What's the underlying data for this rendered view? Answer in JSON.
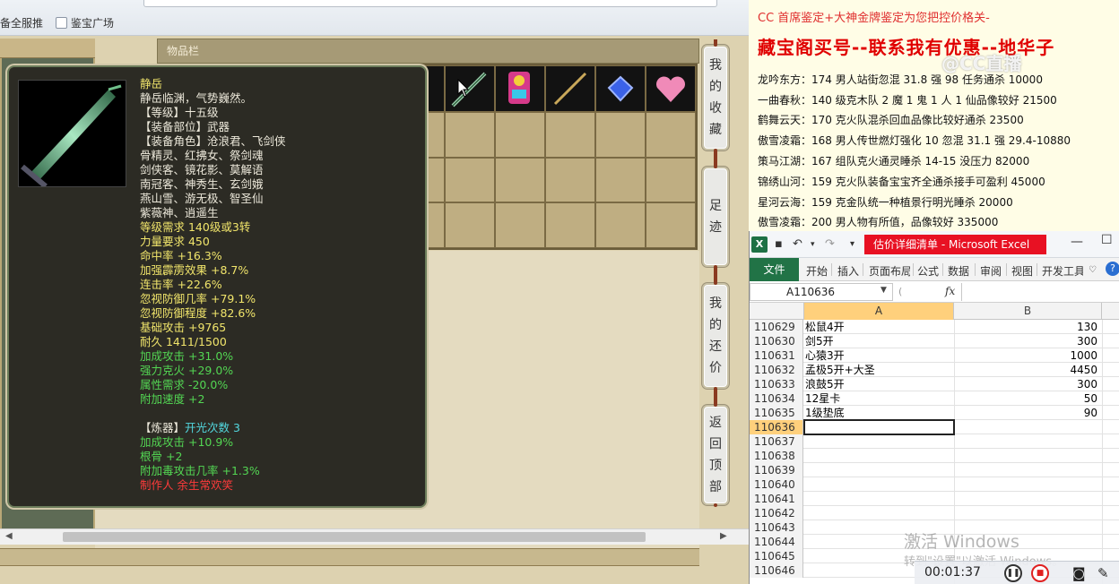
{
  "browser": {
    "bookmarks": [
      "备全服推",
      "鉴宝广场"
    ]
  },
  "game": {
    "items_title": "物品栏",
    "side_buttons": [
      [
        "我",
        "的",
        "收",
        "藏"
      ],
      [
        "足",
        "迹"
      ],
      [
        "我",
        "的",
        "还",
        "价"
      ],
      [
        "返",
        "回",
        "顶",
        "部"
      ]
    ],
    "tooltip": {
      "name": "静岳",
      "desc": "静岳临渊，气势巍然。",
      "level_line": "【等级】十五级",
      "slot_line": "【装备部位】武器",
      "roles_line": "【装备角色】沧浪君、飞剑侠",
      "roles": [
        "骨精灵、红拂女、祭剑魂",
        "剑侠客、镜花影、莫解语",
        "南冠客、神秀生、玄剑娥",
        "燕山雪、游无极、智圣仙",
        "紫薇神、逍遥生"
      ],
      "requirement": "等级需求 140级或3转",
      "strength": "力量要求 450",
      "stats": [
        "命中率 +16.3%",
        "加强霹雳效果 +8.7%",
        "连击率 +22.6%",
        "忽视防御几率 +79.1%",
        "忽视防御程度 +82.6%",
        "基础攻击 +9765",
        "耐久 1411/1500"
      ],
      "green_stats": [
        "加成攻击 +31.0%",
        "强力克火 +29.0%",
        "属性需求 -20.0%",
        "附加速度 +2"
      ],
      "refine_label": "【炼器】",
      "refine_value": "开光次数 3",
      "refine_stats": [
        "加成攻击 +10.9%",
        "根骨 +2",
        "附加毒攻击几率 +1.3%"
      ],
      "maker": "制作人 余生常欢笑"
    }
  },
  "auction": {
    "header": "CC 首席鉴定+大神金牌鉴定为您把控价格关-",
    "headline": "藏宝阁买号--联系我有优惠--地华子",
    "rows": [
      "龙吟东方：174 男人站街忽混 31.8 强 98 任务通杀 10000",
      "一曲春秋：140 级克木队 2 魔 1 鬼 1 人 1 仙品像较好 21500",
      "鹤舞云天：170 克火队混杀回血品像比较好通杀 23500",
      "傲雪凌霜：168 男人传世燃灯强化 10 忽混 31.1 强 29.4-10880",
      "策马江湖：167 组队克火通灵睡杀 14-15 没压力 82000",
      "锦绣山河：159 克火队装备宝宝齐全通杀接手可盈利 45000",
      "星河云海：159 克金队统一种植景行明光睡杀 20000",
      "傲雪凌霜：200 男人物有所值，品像较好 335000"
    ],
    "watermark": "@CC直播"
  },
  "excel": {
    "logo": "X",
    "title": "估价详细清单 - Microsoft Excel",
    "file_tab": "文件",
    "tabs": [
      "开始",
      "插入",
      "页面布局",
      "公式",
      "数据",
      "审阅",
      "视图",
      "开发工具"
    ],
    "name_box": "A110636",
    "fx": "fx",
    "col_a": "A",
    "col_b": "B",
    "rows": [
      {
        "n": "110629",
        "a": "松鼠4开",
        "b": "130"
      },
      {
        "n": "110630",
        "a": "剑5开",
        "b": "300"
      },
      {
        "n": "110631",
        "a": "心猿3开",
        "b": "1000"
      },
      {
        "n": "110632",
        "a": "孟极5开+大圣",
        "b": "4450"
      },
      {
        "n": "110633",
        "a": "浪鼓5开",
        "b": "300"
      },
      {
        "n": "110634",
        "a": "12星卡",
        "b": "50"
      },
      {
        "n": "110635",
        "a": "1级垫底",
        "b": "90"
      },
      {
        "n": "110636",
        "a": "",
        "b": ""
      },
      {
        "n": "110637",
        "a": "",
        "b": ""
      },
      {
        "n": "110638",
        "a": "",
        "b": ""
      },
      {
        "n": "110639",
        "a": "",
        "b": ""
      },
      {
        "n": "110640",
        "a": "",
        "b": ""
      },
      {
        "n": "110641",
        "a": "",
        "b": ""
      },
      {
        "n": "110642",
        "a": "",
        "b": ""
      },
      {
        "n": "110643",
        "a": "",
        "b": ""
      },
      {
        "n": "110644",
        "a": "",
        "b": ""
      },
      {
        "n": "110645",
        "a": "",
        "b": ""
      },
      {
        "n": "110646",
        "a": "",
        "b": ""
      }
    ]
  },
  "windows_watermark": {
    "line1": "激活 Windows",
    "line2": "转到\"设置\"以激活 Windows。"
  },
  "recorder": {
    "time": "00:01:37"
  }
}
